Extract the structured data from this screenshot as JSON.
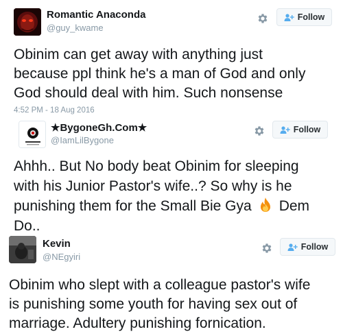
{
  "tweets": [
    {
      "name": "Romantic Anaconda",
      "handle": "@guy_kwame",
      "follow": "Follow",
      "lines": [
        "Obinim can get away with anything just",
        "because ppl think he's a man of God and only",
        "God should deal with him. Such nonsense"
      ],
      "timestamp": "4:52 PM - 18 Aug 2016"
    },
    {
      "name": "★BygoneGh.Com★",
      "handle": "@IamLilBygone",
      "follow": "Follow",
      "lines": [
        "Ahhh.. But No body beat Obinim for sleeping",
        "with his Junior Pastor's wife..? So why is he",
        "punishing them for the Small Bie Gya",
        "Dem",
        "Do.."
      ]
    },
    {
      "name": "Kevin",
      "handle": "@NEgyiri",
      "follow": "Follow",
      "lines": [
        "Obinim who slept with a colleague pastor's wife",
        "is punishing some youth for having sex out of",
        "marriage.  Adultery punishing fornication."
      ]
    }
  ],
  "icons": {
    "gear": "gear-icon",
    "follow": "add-user-icon",
    "fire": "fire-emoji"
  },
  "colors": {
    "text": "#14171a",
    "secondary": "#8899a6",
    "button_bg": "#f5f8fa",
    "button_border": "#e1e8ed"
  }
}
